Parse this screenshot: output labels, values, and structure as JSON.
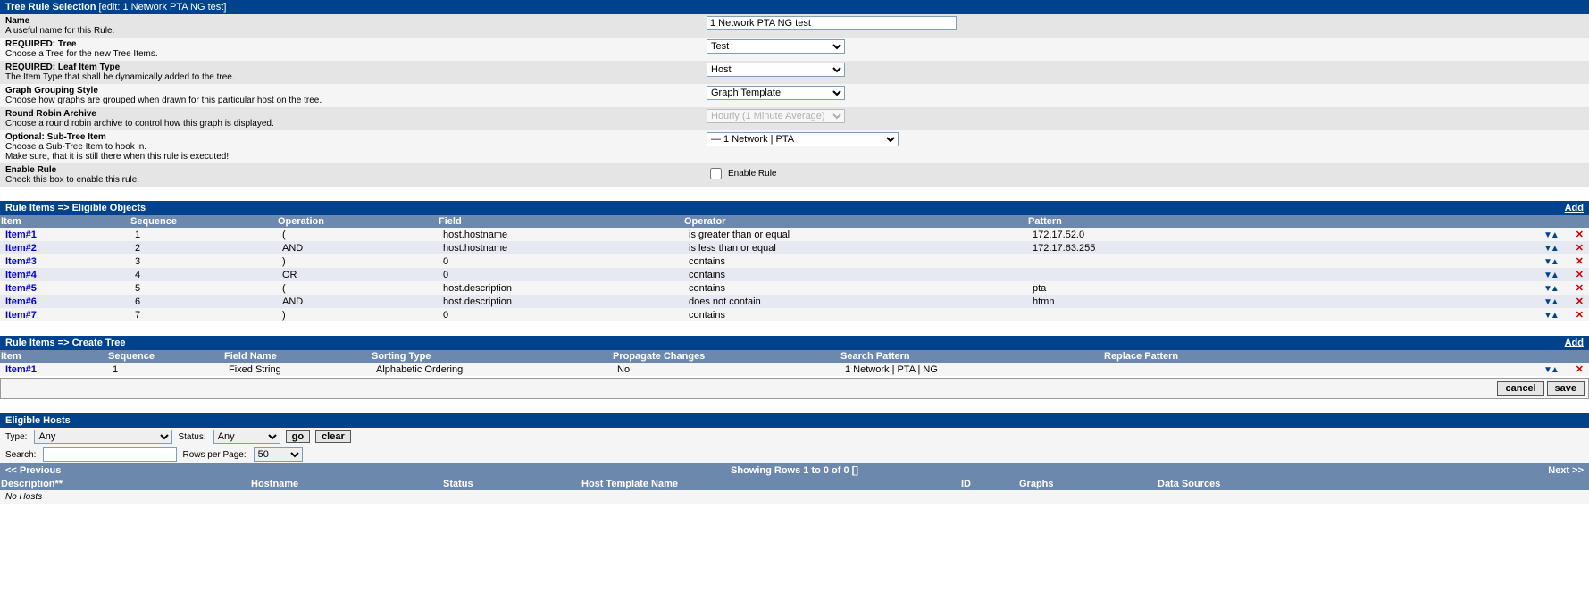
{
  "tree_rule": {
    "header": "Tree Rule Selection",
    "sub": "[edit: 1 Network PTA NG test]",
    "rows": [
      {
        "title": "Name",
        "desc": "A useful name for this Rule.",
        "type": "text",
        "value": "1 Network PTA NG test"
      },
      {
        "title": "REQUIRED: Tree",
        "desc": "Choose a Tree for the new Tree Items.",
        "type": "select",
        "value": "Test"
      },
      {
        "title": "REQUIRED: Leaf Item Type",
        "desc": "The Item Type that shall be dynamically added to the tree.",
        "type": "select",
        "value": "Host"
      },
      {
        "title": "Graph Grouping Style",
        "desc": "Choose how graphs are grouped when drawn for this particular host on the tree.",
        "type": "select",
        "value": "Graph Template"
      },
      {
        "title": "Round Robin Archive",
        "desc": "Choose a round robin archive to control how this graph is displayed.",
        "type": "select-disabled",
        "value": "Hourly (1 Minute Average)"
      },
      {
        "title": "Optional: Sub-Tree Item",
        "desc": "Choose a Sub-Tree Item to hook in.\nMake sure, that it is still there when this rule is executed!",
        "type": "select-wide",
        "value": "— 1 Network | PTA"
      },
      {
        "title": "Enable Rule",
        "desc": "Check this box to enable this rule.",
        "type": "checkbox",
        "value": "Enable Rule"
      }
    ]
  },
  "eligible_items": {
    "header": "Rule Items => Eligible Objects",
    "add": "Add",
    "cols": [
      "Item",
      "Sequence",
      "Operation",
      "Field",
      "Operator",
      "Pattern"
    ],
    "rows": [
      {
        "item": "Item#1",
        "seq": "1",
        "op": "(",
        "field": "host.hostname",
        "oper": "is greater than or equal",
        "pat": "172.17.52.0"
      },
      {
        "item": "Item#2",
        "seq": "2",
        "op": "AND",
        "field": "host.hostname",
        "oper": "is less than or equal",
        "pat": "172.17.63.255"
      },
      {
        "item": "Item#3",
        "seq": "3",
        "op": ")",
        "field": "0",
        "oper": "contains",
        "pat": ""
      },
      {
        "item": "Item#4",
        "seq": "4",
        "op": "OR",
        "field": "0",
        "oper": "contains",
        "pat": ""
      },
      {
        "item": "Item#5",
        "seq": "5",
        "op": "(",
        "field": "host.description",
        "oper": "contains",
        "pat": "pta"
      },
      {
        "item": "Item#6",
        "seq": "6",
        "op": "AND",
        "field": "host.description",
        "oper": "does not contain",
        "pat": "htmn"
      },
      {
        "item": "Item#7",
        "seq": "7",
        "op": ")",
        "field": "0",
        "oper": "contains",
        "pat": ""
      }
    ]
  },
  "create_tree": {
    "header": "Rule Items => Create Tree",
    "add": "Add",
    "cols": [
      "Item",
      "Sequence",
      "Field Name",
      "Sorting Type",
      "Propagate Changes",
      "Search Pattern",
      "Replace Pattern"
    ],
    "rows": [
      {
        "item": "Item#1",
        "seq": "1",
        "fname": "Fixed String",
        "sort": "Alphabetic Ordering",
        "prop": "No",
        "search": "1 Network | PTA | NG",
        "replace": ""
      }
    ]
  },
  "buttons": {
    "cancel": "cancel",
    "save": "save"
  },
  "hosts": {
    "header": "Eligible Hosts",
    "filter": {
      "type_label": "Type:",
      "type_value": "Any",
      "status_label": "Status:",
      "status_value": "Any",
      "go": "go",
      "clear": "clear",
      "search_label": "Search:",
      "search_value": "",
      "rows_label": "Rows per Page:",
      "rows_value": "50"
    },
    "pager": {
      "prev": "<< Previous",
      "info": "Showing Rows 1 to 0 of 0 []",
      "next": "Next >>"
    },
    "cols": [
      "Description**",
      "Hostname",
      "Status",
      "Host Template Name",
      "ID",
      "Graphs",
      "Data Sources"
    ],
    "empty": "No Hosts"
  }
}
